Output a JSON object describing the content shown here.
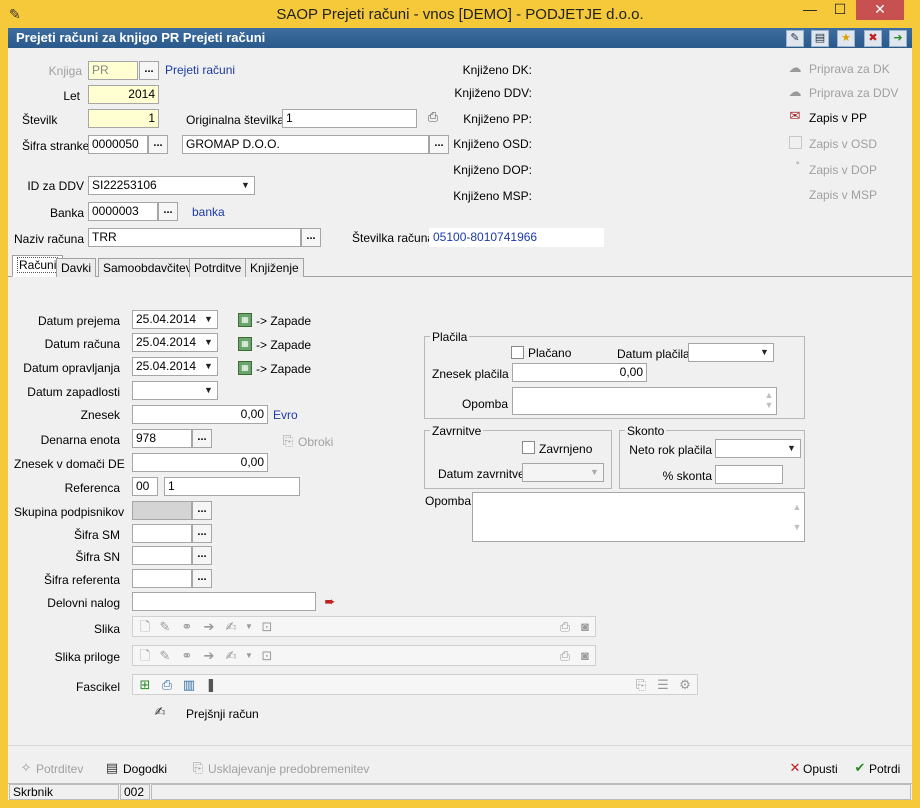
{
  "window": {
    "title": "SAOP Prejeti računi - vnos [DEMO] - PODJETJE d.o.o.",
    "minimize": "—",
    "maximize": "☐",
    "close": "✕"
  },
  "header": {
    "title": "Prejeti računi za knjigo PR Prejeti računi"
  },
  "form": {
    "knjiga_label": "Knjiga",
    "knjiga_value": "PR",
    "knjiga_name": "Prejeti računi",
    "let_label": "Let",
    "let_value": "2014",
    "stevilka_label": "Številk",
    "stevilka_value": "1",
    "orig_label": "Originalna številka",
    "orig_value": "1",
    "sifra_stranke_label": "Šifra stranke",
    "sifra_stranke_value": "0000050",
    "stranka_name": "GROMAP D.O.O.",
    "idddv_label": "ID za DDV",
    "idddv_value": "SI22253106",
    "banka_label": "Banka",
    "banka_value": "0000003",
    "banka_link": "banka",
    "naziv_label": "Naziv računa",
    "naziv_value": "TRR",
    "stevilka_racuna_label": "Številka računa",
    "stevilka_racuna_value": "05100-8010741966",
    "ellipsis": "..."
  },
  "booked": {
    "dk": "Knjiženo DK:",
    "ddv": "Knjiženo DDV:",
    "pp": "Knjiženo PP:",
    "osd": "Knjiženo OSD:",
    "dop": "Knjiženo DOP:",
    "msp": "Knjiženo MSP:"
  },
  "actions": {
    "priprava_dk": "Priprava za DK",
    "priprava_ddv": "Priprava za DDV",
    "zapis_pp": "Zapis v PP",
    "zapis_osd": "Zapis v OSD",
    "zapis_dop": "Zapis v DOP",
    "zapis_msp": "Zapis v MSP"
  },
  "tabs": [
    "Računi",
    "Davki",
    "Samoobdavčitev",
    "Potrditve",
    "Knjiženje"
  ],
  "racuni": {
    "datum_prejema_label": "Datum prejema",
    "datum_prejema": "25.04.2014",
    "datum_racuna_label": "Datum računa",
    "datum_racuna": "25.04.2014",
    "datum_opr_label": "Datum opravljanja",
    "datum_opr": "25.04.2014",
    "zapade": "-> Zapade",
    "datum_zap_label": "Datum zapadlosti",
    "znesek_label": "Znesek",
    "znesek": "0,00",
    "valuta": "Evro",
    "denarna_label": "Denarna enota",
    "denarna": "978",
    "obroki": "Obroki",
    "znesek_dom_label": "Znesek v domači DE",
    "znesek_dom": "0,00",
    "referenca_label": "Referenca",
    "referenca_a": "00",
    "referenca_b": "1",
    "skupina_label": "Skupina podpisnikov",
    "sifra_sm_label": "Šifra SM",
    "sifra_sn_label": "Šifra SN",
    "sifra_ref_label": "Šifra referenta",
    "delovni_label": "Delovni nalog",
    "slika_label": "Slika",
    "slika_priloge_label": "Slika priloge",
    "fascikel_label": "Fascikel",
    "prejsnji": "Prejšnji račun"
  },
  "placila": {
    "group": "Plačila",
    "placano": "Plačano",
    "datum_placila_label": "Datum plačila",
    "znesek_placila_label": "Znesek plačila",
    "znesek_placila": "0,00",
    "opomba_label": "Opomba"
  },
  "zavrnitve": {
    "group": "Zavrnitve",
    "zavrnjeno": "Zavrnjeno",
    "datum_label": "Datum zavrnitve"
  },
  "skonto": {
    "group": "Skonto",
    "neto_label": "Neto rok plačila",
    "pct_label": "% skonta"
  },
  "opomba_label": "Opomba",
  "bottom": {
    "potrditev": "Potrditev",
    "dogodki": "Dogodki",
    "usklajevanje": "Usklajevanje predobremenitev",
    "opusti": "Opusti",
    "potrdi": "Potrdi"
  },
  "status": {
    "skrbnik": "Skrbnik",
    "code": "002"
  }
}
